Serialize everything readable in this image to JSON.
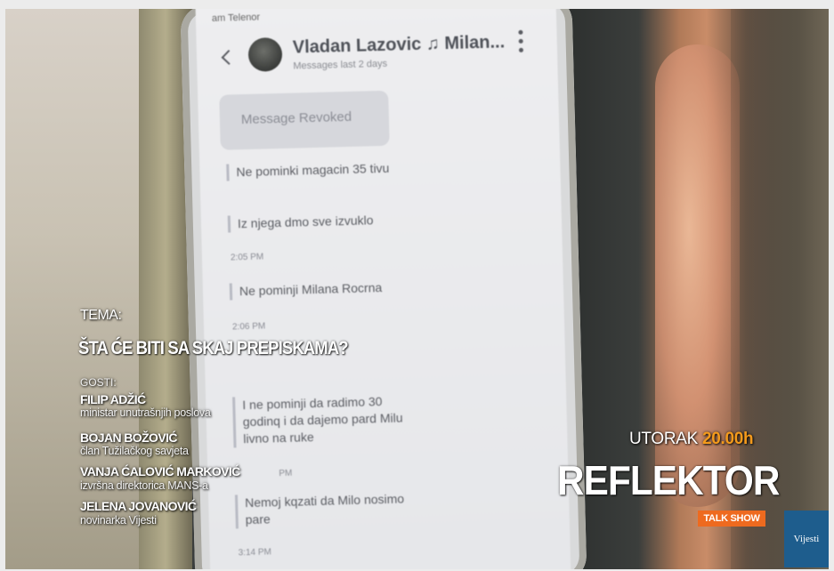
{
  "chat": {
    "status_bar": "am Telenor",
    "contact_name": "Vladan Lazovic ♫ Milan...",
    "contact_sub": "Messages last 2 days",
    "revoked": "Message Revoked",
    "messages": [
      {
        "text": "Ne pominki magacin 35 tivu"
      },
      {
        "text": "Iz njega dmo sve izvuklo"
      },
      {
        "time": "2:05 PM"
      },
      {
        "text": "Ne pominji Milana Rocrna"
      },
      {
        "time": "2:06 PM"
      },
      {
        "text": "I ne pominji da radimo 30\ngodinq i da dajemo pard Milu\nlivno na ruke"
      },
      {
        "time": "PM"
      },
      {
        "text": "Nemoj kqzati da Milo nosimo\npare"
      },
      {
        "time": "3:14 PM"
      }
    ]
  },
  "overlay": {
    "tema_label": "TEMA:",
    "tema_title": "ŠTA ĆE BITI SA SKAJ PREPISKAMA?",
    "gosti_label": "GOSTI:",
    "guests": [
      {
        "name": "FILIP ADŽIĆ",
        "role": "ministar unutrašnjih poslova"
      },
      {
        "name": "BOJAN BOŽOVIĆ",
        "role": "član Tužilačkog savjeta"
      },
      {
        "name": "VANJA ĆALOVIĆ MARKOVIĆ",
        "role": "izvršna direktorica MANS-a"
      },
      {
        "name": "JELENA JOVANOVIĆ",
        "role": "novinarka Vijesti"
      }
    ],
    "day": "UTORAK",
    "hour": "20.00h",
    "show_title": "REFLEKTOR",
    "show_type": "TALK SHOW",
    "logo": "Vijesti"
  },
  "colors": {
    "accent": "#f39a1c",
    "badge": "#ee6a1f",
    "logo_bg": "#1e5d8d"
  }
}
